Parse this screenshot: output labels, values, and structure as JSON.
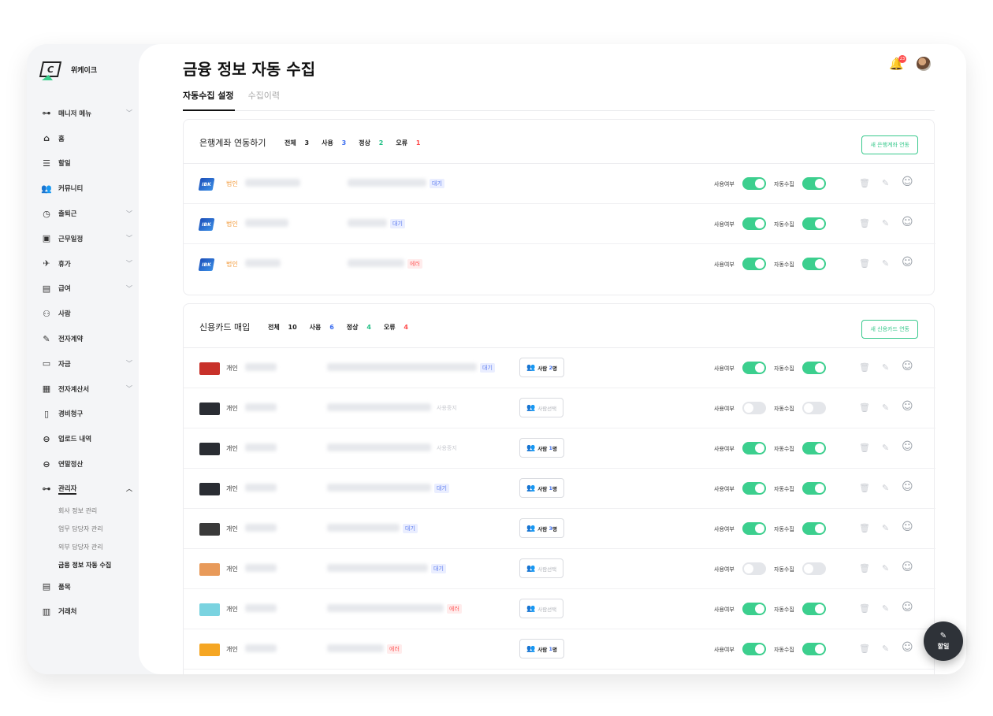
{
  "app": {
    "name": "위케이크"
  },
  "sidebar": {
    "items": [
      {
        "label": "매니저 메뉴",
        "icon": "key-icon",
        "glyph": "⊶",
        "chevron": true
      },
      {
        "label": "홈",
        "icon": "home-icon",
        "glyph": "⌂",
        "chevron": false
      },
      {
        "label": "할일",
        "icon": "list-icon",
        "glyph": "☰",
        "chevron": false
      },
      {
        "label": "커뮤니티",
        "icon": "people-icon",
        "glyph": "👥",
        "chevron": false
      },
      {
        "label": "출퇴근",
        "icon": "clock-icon",
        "glyph": "◷",
        "chevron": true
      },
      {
        "label": "근무일정",
        "icon": "calendar-icon",
        "glyph": "▣",
        "chevron": true
      },
      {
        "label": "휴가",
        "icon": "plane-icon",
        "glyph": "✈",
        "chevron": true
      },
      {
        "label": "급여",
        "icon": "wallet-icon",
        "glyph": "▤",
        "chevron": true
      },
      {
        "label": "사람",
        "icon": "users-icon",
        "glyph": "⚇",
        "chevron": false
      },
      {
        "label": "전자계약",
        "icon": "pen-icon",
        "glyph": "✎",
        "chevron": false
      },
      {
        "label": "자금",
        "icon": "card-icon",
        "glyph": "▭",
        "chevron": true
      },
      {
        "label": "전자계산서",
        "icon": "invoice-icon",
        "glyph": "▦",
        "chevron": true
      },
      {
        "label": "경비청구",
        "icon": "receipt-icon",
        "glyph": "▯",
        "chevron": false
      },
      {
        "label": "업로드 내역",
        "icon": "link-icon",
        "glyph": "⊖",
        "chevron": false
      },
      {
        "label": "연말정산",
        "icon": "link-icon",
        "glyph": "⊖",
        "chevron": false
      },
      {
        "label": "관리자",
        "icon": "key-icon",
        "glyph": "⊶",
        "chevron": true,
        "active": true
      }
    ],
    "sub_items": [
      "회사 정보 관리",
      "업무 담당자 관리",
      "외부 담당자 관리",
      "금융 정보 자동 수집"
    ],
    "bottom_items": [
      {
        "label": "품목",
        "icon": "box-icon",
        "glyph": "▤"
      },
      {
        "label": "거래처",
        "icon": "building-icon",
        "glyph": "▥"
      }
    ]
  },
  "header": {
    "title": "금융 정보 자동 수집",
    "tabs": [
      "자동수집 설정",
      "수집이력"
    ],
    "notification_count": "23"
  },
  "bank_section": {
    "title": "은행계좌 연동하기",
    "stats": {
      "total_label": "전체",
      "total": "3",
      "use_label": "사용",
      "use": "3",
      "ok_label": "정상",
      "ok": "2",
      "err_label": "오류",
      "err": "1"
    },
    "button": "새 은행계좌 연동",
    "rows": [
      {
        "category": "법인",
        "status": "대기",
        "status_type": "wait",
        "use": true,
        "auto": true
      },
      {
        "category": "법인",
        "status": "대기",
        "status_type": "wait",
        "use": true,
        "auto": true
      },
      {
        "category": "법인",
        "status": "에러",
        "status_type": "err",
        "use": true,
        "auto": true
      }
    ]
  },
  "card_section": {
    "title": "신용카드 매입",
    "stats": {
      "total_label": "전체",
      "total": "10",
      "use_label": "사용",
      "use": "6",
      "ok_label": "정상",
      "ok": "4",
      "err_label": "오류",
      "err": "4"
    },
    "button": "새 신용카드 연동",
    "rows": [
      {
        "category": "개인",
        "status": "대기",
        "status_type": "wait",
        "owner_label": "사람",
        "owner_count": "2",
        "owner_suffix": "명",
        "use": true,
        "auto": true,
        "color": "#c8312a"
      },
      {
        "category": "개인",
        "status": "사용중지",
        "status_type": "stop",
        "owner_label": "사람선택",
        "owner_count": "",
        "owner_suffix": "",
        "use": false,
        "auto": false,
        "color": "#2a2d33"
      },
      {
        "category": "개인",
        "status": "사용중지",
        "status_type": "stop",
        "owner_label": "사람",
        "owner_count": "1",
        "owner_suffix": "명",
        "use": true,
        "auto": true,
        "color": "#2a2d33"
      },
      {
        "category": "개인",
        "status": "대기",
        "status_type": "wait",
        "owner_label": "사람",
        "owner_count": "1",
        "owner_suffix": "명",
        "use": true,
        "auto": true,
        "color": "#2a2d33"
      },
      {
        "category": "개인",
        "status": "대기",
        "status_type": "wait",
        "owner_label": "사람",
        "owner_count": "3",
        "owner_suffix": "명",
        "use": true,
        "auto": true,
        "color": "#3a3a3a"
      },
      {
        "category": "개인",
        "status": "대기",
        "status_type": "wait",
        "owner_label": "사람선택",
        "owner_count": "",
        "owner_suffix": "",
        "use": false,
        "auto": false,
        "color": "#e89a5a"
      },
      {
        "category": "개인",
        "status": "에러",
        "status_type": "err",
        "owner_label": "사람선택",
        "owner_count": "",
        "owner_suffix": "",
        "use": true,
        "auto": true,
        "color": "#7ad3e0"
      },
      {
        "category": "개인",
        "status": "에러",
        "status_type": "err",
        "owner_label": "사람",
        "owner_count": "1",
        "owner_suffix": "명",
        "use": true,
        "auto": true,
        "color": "#f5a623"
      }
    ]
  },
  "labels": {
    "use": "사용여부",
    "auto": "자동수집"
  },
  "fab": {
    "label": "할일"
  }
}
